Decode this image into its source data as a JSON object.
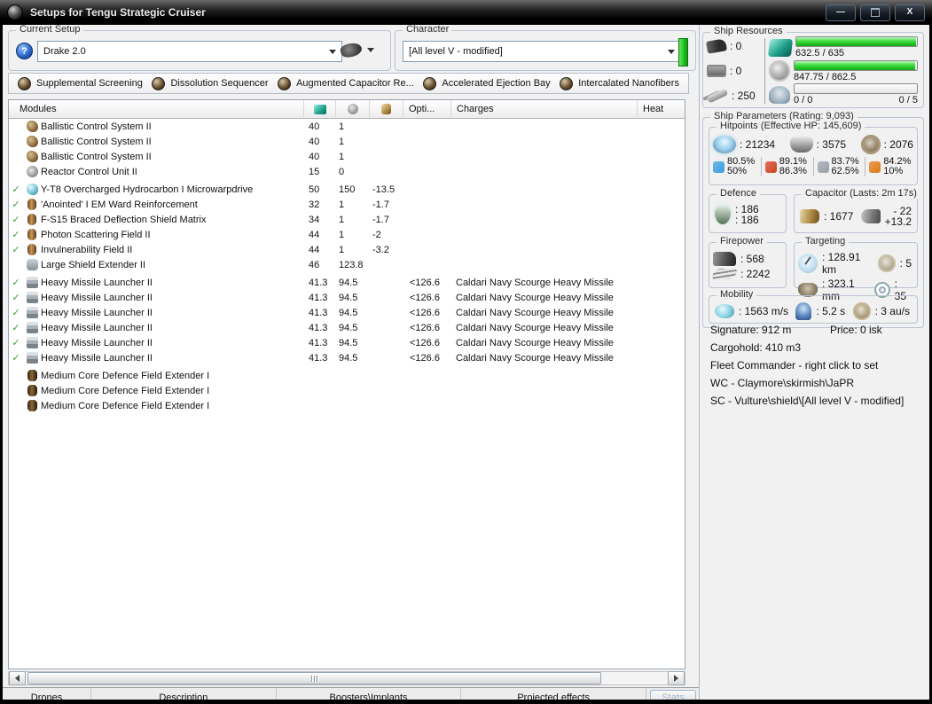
{
  "window": {
    "title": "Setups for Tengu Strategic Cruiser",
    "minimize_glyph": "—",
    "close_glyph": "X"
  },
  "icons": {
    "help": "?",
    "check": "✓"
  },
  "current_setup": {
    "label": "Current Setup",
    "value": "Drake 2.0"
  },
  "character": {
    "label": "Character",
    "value": "[All level V - modified]"
  },
  "subsystem_tabs": [
    "Supplemental Screening",
    "Dissolution Sequencer",
    "Augmented Capacitor Re...",
    "Accelerated Ejection Bay",
    "Intercalated Nanofibers"
  ],
  "modules": {
    "header": {
      "title": "Modules",
      "opti": "Opti...",
      "charges": "Charges",
      "heat": "Heat"
    },
    "groups": [
      {
        "name": "low-slots",
        "rows": [
          {
            "fitted": false,
            "icon": "bcs",
            "name": "Ballistic Control System II",
            "cpu": "40",
            "pg": "1",
            "cap": "",
            "opti": "",
            "charge": ""
          },
          {
            "fitted": false,
            "icon": "bcs",
            "name": "Ballistic Control System II",
            "cpu": "40",
            "pg": "1",
            "cap": "",
            "opti": "",
            "charge": ""
          },
          {
            "fitted": false,
            "icon": "bcs",
            "name": "Ballistic Control System II",
            "cpu": "40",
            "pg": "1",
            "cap": "",
            "opti": "",
            "charge": ""
          },
          {
            "fitted": false,
            "icon": "rcu",
            "name": "Reactor Control Unit II",
            "cpu": "15",
            "pg": "0",
            "cap": "",
            "opti": "",
            "charge": ""
          }
        ]
      },
      {
        "name": "mid-slots",
        "rows": [
          {
            "fitted": true,
            "icon": "mwd",
            "name": "Y-T8 Overcharged Hydrocarbon I Microwarpdrive",
            "cpu": "50",
            "pg": "150",
            "cap": "-13.5",
            "opti": "",
            "charge": ""
          },
          {
            "fitted": true,
            "icon": "hardener",
            "name": "'Anointed' I EM Ward Reinforcement",
            "cpu": "32",
            "pg": "1",
            "cap": "-1.7",
            "opti": "",
            "charge": ""
          },
          {
            "fitted": true,
            "icon": "hardener",
            "name": "F-S15 Braced Deflection Shield Matrix",
            "cpu": "34",
            "pg": "1",
            "cap": "-1.7",
            "opti": "",
            "charge": ""
          },
          {
            "fitted": true,
            "icon": "hardener",
            "name": "Photon Scattering Field II",
            "cpu": "44",
            "pg": "1",
            "cap": "-2",
            "opti": "",
            "charge": ""
          },
          {
            "fitted": true,
            "icon": "hardener",
            "name": "Invulnerability Field II",
            "cpu": "44",
            "pg": "1",
            "cap": "-3.2",
            "opti": "",
            "charge": ""
          },
          {
            "fitted": false,
            "icon": "lse",
            "name": "Large Shield Extender II",
            "cpu": "46",
            "pg": "123.8",
            "cap": "",
            "opti": "",
            "charge": ""
          }
        ]
      },
      {
        "name": "high-slots",
        "rows": [
          {
            "fitted": true,
            "icon": "launcher",
            "name": "Heavy Missile Launcher II",
            "cpu": "41.3",
            "pg": "94.5",
            "cap": "",
            "opti": "<126.6",
            "charge": "Caldari Navy Scourge Heavy Missile"
          },
          {
            "fitted": true,
            "icon": "launcher",
            "name": "Heavy Missile Launcher II",
            "cpu": "41.3",
            "pg": "94.5",
            "cap": "",
            "opti": "<126.6",
            "charge": "Caldari Navy Scourge Heavy Missile"
          },
          {
            "fitted": true,
            "icon": "launcher",
            "name": "Heavy Missile Launcher II",
            "cpu": "41.3",
            "pg": "94.5",
            "cap": "",
            "opti": "<126.6",
            "charge": "Caldari Navy Scourge Heavy Missile"
          },
          {
            "fitted": true,
            "icon": "launcher",
            "name": "Heavy Missile Launcher II",
            "cpu": "41.3",
            "pg": "94.5",
            "cap": "",
            "opti": "<126.6",
            "charge": "Caldari Navy Scourge Heavy Missile"
          },
          {
            "fitted": true,
            "icon": "launcher",
            "name": "Heavy Missile Launcher II",
            "cpu": "41.3",
            "pg": "94.5",
            "cap": "",
            "opti": "<126.6",
            "charge": "Caldari Navy Scourge Heavy Missile"
          },
          {
            "fitted": true,
            "icon": "launcher",
            "name": "Heavy Missile Launcher II",
            "cpu": "41.3",
            "pg": "94.5",
            "cap": "",
            "opti": "<126.6",
            "charge": "Caldari Navy Scourge Heavy Missile"
          }
        ]
      },
      {
        "name": "rig-slots",
        "rows": [
          {
            "fitted": false,
            "icon": "rig",
            "name": "Medium Core Defence Field Extender I",
            "cpu": "",
            "pg": "",
            "cap": "",
            "opti": "",
            "charge": ""
          },
          {
            "fitted": false,
            "icon": "rig",
            "name": "Medium Core Defence Field Extender I",
            "cpu": "",
            "pg": "",
            "cap": "",
            "opti": "",
            "charge": ""
          },
          {
            "fitted": false,
            "icon": "rig",
            "name": "Medium Core Defence Field Extender I",
            "cpu": "",
            "pg": "",
            "cap": "",
            "opti": "",
            "charge": ""
          }
        ]
      }
    ]
  },
  "bottom_tabs": [
    "Drones",
    "Description",
    "Boosters\\Implants",
    "Projected effects"
  ],
  "stats_button": "Stats",
  "ship_resources": {
    "label": "Ship Resources",
    "turrets": ": 0",
    "launchers": ": 0",
    "calibration": ": 250",
    "cpu": {
      "text": "632.5 / 635",
      "pct": 99.6
    },
    "powergrid": {
      "text": "847.75 / 862.5",
      "pct": 98.3
    },
    "drones": {
      "left": "0 / 0",
      "right": "0 / 5",
      "pct": 0
    }
  },
  "ship_parameters": {
    "label": "Ship Parameters (Rating: 9,093)",
    "hitpoints": {
      "label": "Hitpoints (Effective HP: 145,609)",
      "shield": ": 21234",
      "armor": ": 3575",
      "structure": ": 2076",
      "resists": [
        {
          "type": "em",
          "color": "#3b9de0",
          "top": "80.5%",
          "bottom": "50%"
        },
        {
          "type": "thermal",
          "color": "#d04020",
          "top": "89.1%",
          "bottom": "86.3%"
        },
        {
          "type": "kinetic",
          "color": "#9aa0a8",
          "top": "83.7%",
          "bottom": "62.5%"
        },
        {
          "type": "explosive",
          "color": "#e07818",
          "top": "84.2%",
          "bottom": "10%"
        }
      ]
    },
    "defence": {
      "label": "Defence",
      "top": ": 186",
      "bottom": ": 186"
    },
    "capacitor": {
      "label": "Capacitor (Lasts: 2m 17s)",
      "amount": ": 1677",
      "usage_top": "- 22",
      "usage_bottom": "+13.2"
    },
    "firepower": {
      "label": "Firepower",
      "volley": ": 568",
      "dps": ": 2242"
    },
    "targeting": {
      "label": "Targeting",
      "range": ": 128.91 km",
      "max_targets": ": 5",
      "scan_res": ": 323.1 mm",
      "sensor_strength": ": 35"
    },
    "mobility": {
      "label": "Mobility",
      "speed": ": 1563 m/s",
      "align": ": 5.2 s",
      "warp": ": 3 au/s"
    }
  },
  "info": {
    "signature": "Signature: 912 m",
    "price": "Price: 0 isk",
    "cargohold": "Cargohold: 410 m3",
    "fleet_commander": "Fleet Commander - right click to set",
    "wc": "WC - Claymore\\skirmish\\JaPR",
    "sc": "SC - Vulture\\shield\\[All level V - modified]"
  }
}
